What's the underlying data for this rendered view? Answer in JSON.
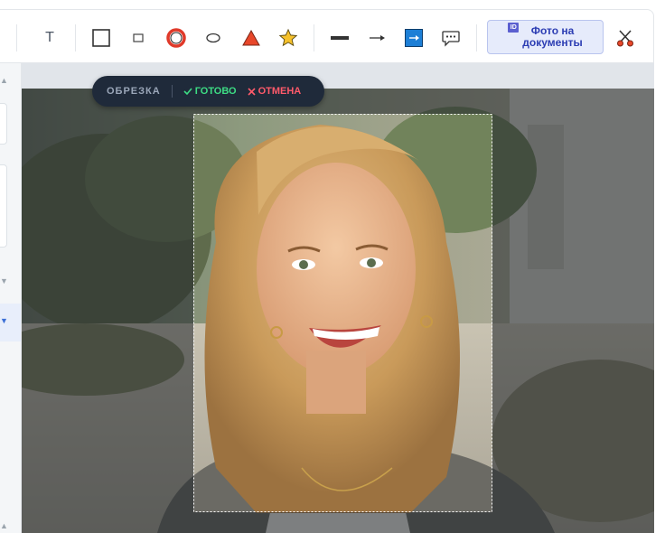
{
  "toolbar": {
    "text_tool": "T",
    "photo_button_label_1": "Фото на",
    "photo_button_label_2": "документы",
    "id_badge": "ID"
  },
  "crop": {
    "title": "ОБРЕЗКА",
    "done": "ГОТОВО",
    "cancel": "ОТМЕНА"
  },
  "colors": {
    "accent": "#2c3db3",
    "done": "#3ddc84",
    "cancel": "#ff5a6a",
    "crop_bar": "#1f2a3a"
  }
}
